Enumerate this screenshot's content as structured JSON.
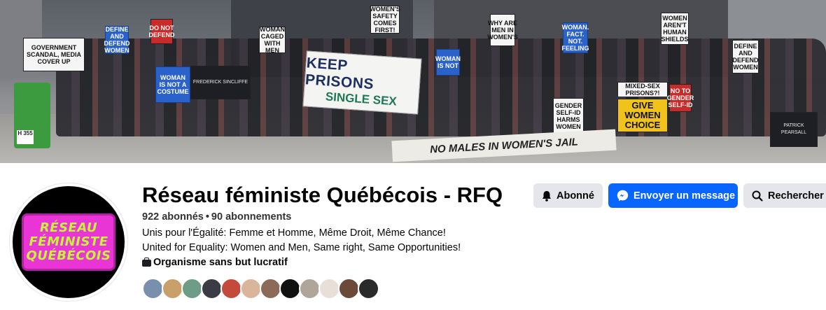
{
  "cover": {
    "signs": {
      "s1": "GOVERNMENT SCANDAL, MEDIA COVER UP",
      "s2": "DEFINE AND DEFEND WOMEN",
      "s3": "DO NOT DEFEND",
      "s4": "WOMAN IS NOT A COSTUME",
      "s5": "WOMAN CAGED WITH MEN",
      "s6": "WOMEN'S SAFETY COMES FIRST!",
      "s7": "WHY ARE MEN IN WOMEN'S",
      "s8": "WOMEN AREN'T HUMAN SHIELDS",
      "s9": "WOMAN. FACT. NOT. FEELING",
      "s10": "WOMAN IS NOT",
      "s11": "GENDER SELF-ID HARMS WOMEN",
      "s12": "MIXED-SEX PRISONS?!",
      "s13": "GIVE WOMEN CHOICE",
      "s14": "DEFINE AND DEFEND WOMEN",
      "s15": "NO TO GENDER SELF-ID",
      "s16": "FREDERICK SINCLIFFE",
      "s17": "PATRICK PEARSALL"
    },
    "banner_line1": "KEEP PRISONS",
    "banner_line2": "SINGLE SEX",
    "floor_banner": "NO MALES IN WOMEN'S JAIL",
    "post_tag": "H 355"
  },
  "profile": {
    "logo_lines": [
      "RÉSEAU",
      "FÉMINISTE",
      "QUÉBÉCOIS"
    ],
    "name": "Réseau féministe Québécois - RFQ",
    "followers": "922 abonnés",
    "following": "90 abonnements",
    "bio_fr": "Unis pour l'Égalité: Femme et Homme, Même Droit, Même Chance!",
    "bio_en": "United for Equality: Women and Men, Same right, Same Opportunities!",
    "category": "Organisme sans but lucratif",
    "friend_colors": [
      "#7a8fae",
      "#c9a06a",
      "#6f9c86",
      "#3b3b46",
      "#c44b3b",
      "#d9b59c",
      "#8b6a5a",
      "#111111",
      "#b0a59a",
      "#e8e0d8",
      "#6b4a3a",
      "#2a2a2a"
    ]
  },
  "actions": {
    "subscribed": "Abonné",
    "message": "Envoyer un message",
    "search": "Rechercher"
  },
  "colors": {
    "primary": "#0866ff",
    "secondary_bg": "#e4e6eb",
    "logo_pink": "#e934d6",
    "logo_green": "#c5f23a"
  }
}
